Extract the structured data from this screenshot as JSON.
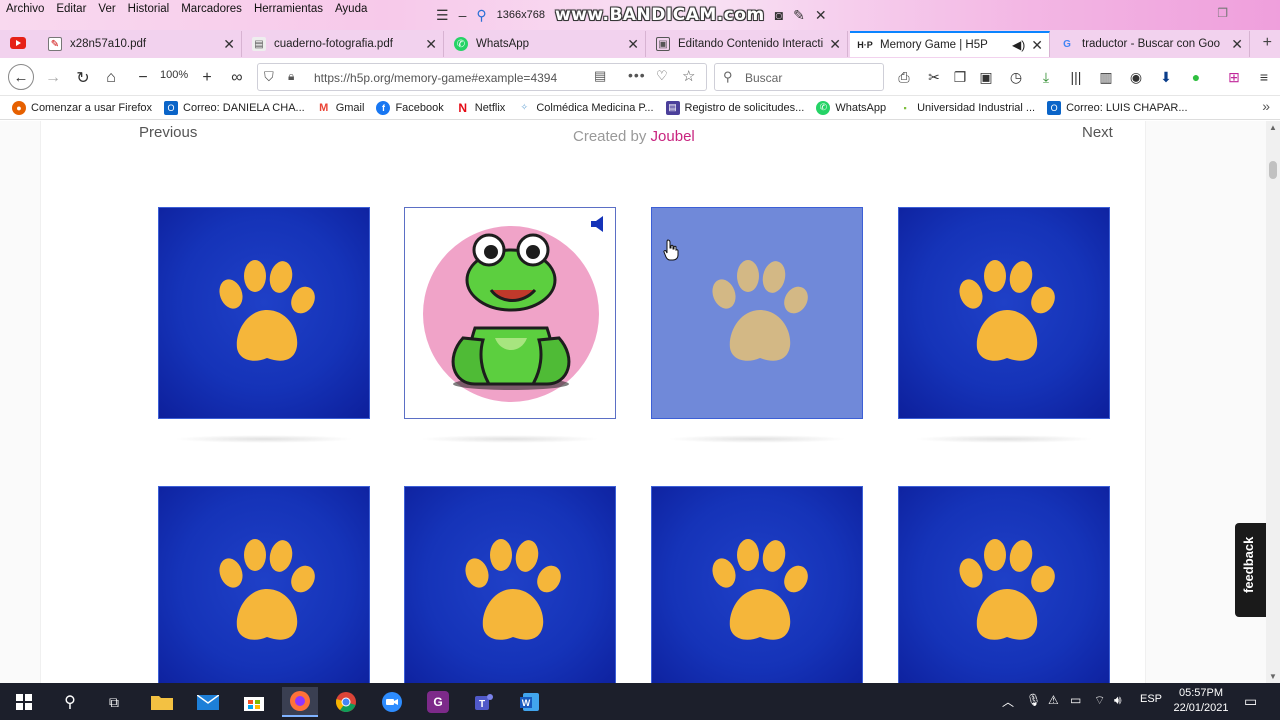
{
  "menu": [
    "Archivo",
    "Editar",
    "Ver",
    "Historial",
    "Marcadores",
    "Herramientas",
    "Ayuda"
  ],
  "recorder": {
    "resolution": "1366x768",
    "brand": "www.BANDICAM.com"
  },
  "tabs": [
    {
      "label": "x28n57a10.pdf",
      "icon": "pdf-icon"
    },
    {
      "label": "cuaderno-fotografia.pdf",
      "icon": "pdf-icon"
    },
    {
      "label": "WhatsApp",
      "icon": "whatsapp-icon"
    },
    {
      "label": "Editando Contenido Interacti",
      "icon": "h5p-icon"
    },
    {
      "label": "Memory Game | H5P",
      "icon": "h5p-icon",
      "active": true
    },
    {
      "label": "traductor - Buscar con Goo",
      "icon": "google-icon"
    }
  ],
  "nav": {
    "zoom": "100%",
    "url": "https://h5p.org/memory-game#example=4394",
    "search_placeholder": "Buscar"
  },
  "bookmarks": [
    {
      "label": "Comenzar a usar Firefox",
      "icon": "firefox-icon",
      "color": "#e66000"
    },
    {
      "label": "Correo: DANIELA CHA...",
      "icon": "outlook-icon",
      "color": "#0a64c8"
    },
    {
      "label": "Gmail",
      "icon": "gmail-icon",
      "color": "#ea4335"
    },
    {
      "label": "Facebook",
      "icon": "facebook-icon",
      "color": "#1877f2"
    },
    {
      "label": "Netflix",
      "icon": "netflix-icon",
      "color": "#e50914"
    },
    {
      "label": "Colmédica Medicina P...",
      "icon": "colmedica-icon",
      "color": "#6aa6d6"
    },
    {
      "label": "Registro de solicitudes...",
      "icon": "registro-icon",
      "color": "#4b3f9a"
    },
    {
      "label": "WhatsApp",
      "icon": "whatsapp-icon",
      "color": "#25d366"
    },
    {
      "label": "Universidad Industrial ...",
      "icon": "uis-icon",
      "color": "#7cbf3a"
    },
    {
      "label": "Correo: LUIS CHAPAR...",
      "icon": "outlook-icon",
      "color": "#0a64c8"
    }
  ],
  "page": {
    "previous": "Previous",
    "next": "Next",
    "created_prefix": "Created by",
    "created_brand": "Joubel",
    "feedback": "feedback"
  },
  "taskbar": {
    "language": "ESP",
    "time": "05:57PM",
    "date": "22/01/2021"
  },
  "colors": {
    "card_back": "#1533b8",
    "paw": "#f5b63a",
    "joubel": "#c8247f",
    "frog": "#5ccf3f"
  }
}
